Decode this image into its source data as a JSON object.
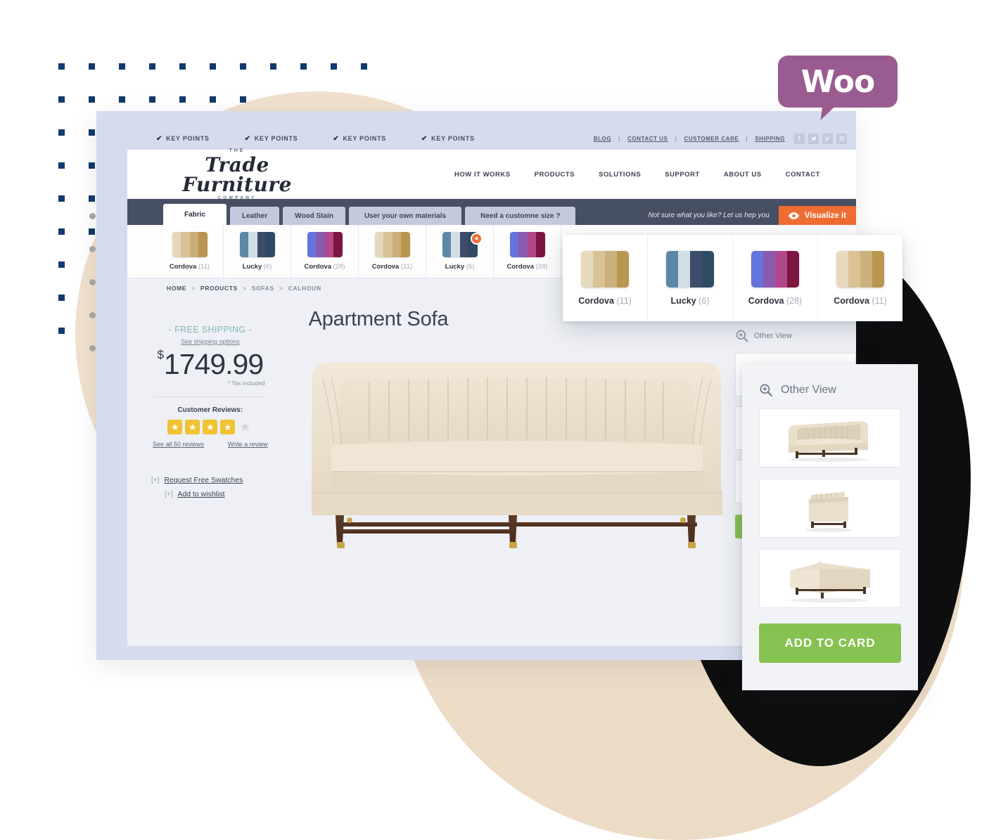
{
  "brand": {
    "the": "THE",
    "name": "Trade Furniture",
    "company": "COMPANY"
  },
  "keypoints": {
    "items": [
      "KEY POINTS",
      "KEY POINTS",
      "KEY POINTS",
      "KEY POINTS"
    ],
    "check_glyph": "✔",
    "links": [
      "BLOG",
      "CONTACT US",
      "CUSTOMER CARE",
      "SHIPPING"
    ],
    "separator": "|",
    "social": [
      {
        "name": "facebook-icon",
        "glyph": "f"
      },
      {
        "name": "twitter-icon",
        "glyph": "ᴠ"
      },
      {
        "name": "google-plus-icon",
        "glyph": "g"
      },
      {
        "name": "instagram-icon",
        "glyph": "▣"
      }
    ]
  },
  "mainnav": {
    "items": [
      "HOW IT WORKS",
      "PRODUCTS",
      "SOLUTIONS",
      "SUPPORT",
      "ABOUT US",
      "CONTACT"
    ]
  },
  "tabs": {
    "items": [
      {
        "label": "Fabric",
        "active": true
      },
      {
        "label": "Leather",
        "active": false
      },
      {
        "label": "Wood Stain",
        "active": false
      },
      {
        "label": "User your own materials",
        "active": false
      },
      {
        "label": "Need a customne size ?",
        "active": false
      }
    ],
    "visualize_note": "Not sure what you like?  Let us hep you",
    "visualize_label": "Visualize it",
    "visualize_color": "#ef6c33"
  },
  "swatch_row": {
    "items": [
      {
        "name": "Cordova",
        "count": "(11)",
        "colors": [
          "#e6d7b9",
          "#d8c194",
          "#c9ae79",
          "#b9954f"
        ],
        "badge": false
      },
      {
        "name": "Lucky",
        "count": "(6)",
        "colors": [
          "#5d87a6",
          "#d2dee5",
          "#3d4c68",
          "#2d4b63"
        ],
        "badge": false
      },
      {
        "name": "Cordova",
        "count": "(28)",
        "colors": [
          "#6573dd",
          "#8a5ab0",
          "#b2478c",
          "#7d1540"
        ],
        "badge": false
      },
      {
        "name": "Cordova",
        "count": "(11)",
        "colors": [
          "#e6d7b9",
          "#d8c194",
          "#c9ae79",
          "#b9954f"
        ],
        "badge": false
      },
      {
        "name": "Lucky",
        "count": "(6)",
        "colors": [
          "#5d87a6",
          "#d2dee5",
          "#3d4c68",
          "#2d4b63"
        ],
        "badge": true
      },
      {
        "name": "Cordova",
        "count": "(28)",
        "colors": [
          "#6573dd",
          "#8a5ab0",
          "#b2478c",
          "#7d1540"
        ],
        "badge": false
      }
    ],
    "badge_glyph": "★"
  },
  "swatch_panel": {
    "items": [
      {
        "name": "Cordova",
        "count": "(11)",
        "colors": [
          "#e7d9bd",
          "#d9c394",
          "#cbb07c",
          "#b99750"
        ]
      },
      {
        "name": "Lucky",
        "count": "(6)",
        "colors": [
          "#5d87a6",
          "#d3dfe6",
          "#3e4d69",
          "#2e4c64"
        ]
      },
      {
        "name": "Cordova",
        "count": "(28)",
        "colors": [
          "#6573dd",
          "#8a5ab0",
          "#b2478c",
          "#7d1540"
        ]
      },
      {
        "name": "Cordova",
        "count": "(11)",
        "colors": [
          "#e7d9bd",
          "#d9c394",
          "#cbb07c",
          "#b99750"
        ]
      }
    ]
  },
  "breadcrumb": {
    "items": [
      "HOME",
      "PRODUCTS",
      "SOFAS",
      "CALHOUN"
    ],
    "separator": ">"
  },
  "product": {
    "title": "Apartment Sofa",
    "free_shipping": "- FREE SHIPPING -",
    "shipping_options": "See shipping options",
    "currency": "$",
    "price": "1749.99",
    "tax_note": "* Tax included",
    "reviews_title": "Customer Reviews:",
    "rating": 4,
    "stars_total": 5,
    "star_glyph": "★",
    "see_reviews": "See all 50 reviews",
    "write_review": "Write a review",
    "plus_glyph": "[+]",
    "request_swatches": "Request Free Swatches",
    "add_wishlist": "Add to wishlist",
    "sofa_alt": "Apartment Sofa cream velvet channel-tufted"
  },
  "right_column": {
    "other_view_label": "Other View"
  },
  "other_view_panel": {
    "title": "Other View",
    "magnifier_icon": "magnifier-plus-icon",
    "thumbs": [
      "sofa-front-angle",
      "sofa-side",
      "sofa-back-angle"
    ],
    "add_to_cart_label": "ADD TO CARD",
    "add_to_cart_color": "#86c251"
  },
  "woo_badge": {
    "label": "Woo",
    "color": "#9a5c90"
  },
  "colors": {
    "navy_dots": "#113a6d",
    "tan_circle": "#f0e1cd",
    "grey_dots": "#a9a9a9",
    "dark_navbar": "#474f63",
    "page_frame": "#d6dced"
  }
}
